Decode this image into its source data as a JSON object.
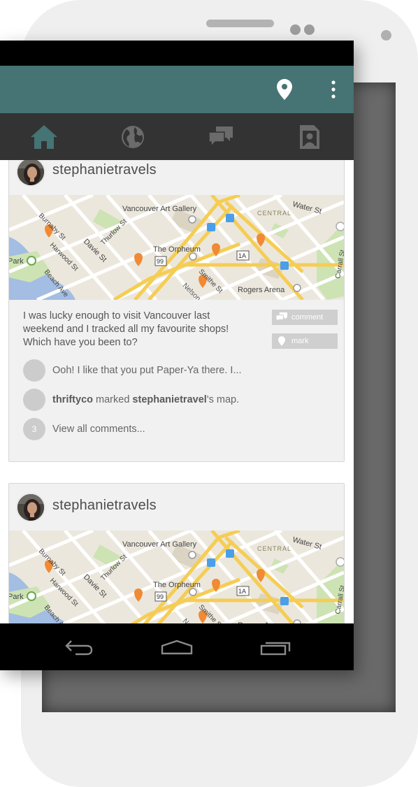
{
  "colors": {
    "action_bar": "#467373",
    "tab_bar": "#333333",
    "active_tab": "#467373",
    "inactive_tab": "#6b6b6b",
    "map_pin": "#f08a35",
    "map_road": "#f5cd54"
  },
  "action_bar": {
    "icons": [
      "location-pin-icon",
      "overflow-menu-icon"
    ]
  },
  "tabs": [
    {
      "icon": "home-icon",
      "active": true
    },
    {
      "icon": "globe-icon",
      "active": false
    },
    {
      "icon": "chat-icon",
      "active": false
    },
    {
      "icon": "profile-card-icon",
      "active": false
    }
  ],
  "map": {
    "labels": {
      "gallery": "Vancouver Art Gallery",
      "water": "Water St",
      "central": "CENTRAL",
      "burnaby": "Burnaby St",
      "thurlow": "Thurlow St",
      "davie": "Davie St",
      "harwood": "Harwood St",
      "orpheum": "The Orpheum",
      "park": "Park",
      "beach": "Beach Ave",
      "nelson": "Nelson",
      "smithe": "Smithe St",
      "rogers": "Rogers Arena",
      "carrall": "Carrall St",
      "route99": "99",
      "route1a": "1A"
    }
  },
  "posts": [
    {
      "username": "stephanietravels",
      "text_lines": [
        "I was lucky enough to visit Vancouver last",
        "weekend and I tracked all my favourite shops!",
        "Which have you been to?"
      ],
      "comment_label": "comment",
      "mark_label": "mark",
      "comments": [
        {
          "text": "Ooh! I like that you put Paper-Ya there. I..."
        },
        {
          "user": "thriftyco",
          "middle": " marked ",
          "target": "stephanietravel",
          "suffix": "'s map."
        }
      ],
      "comment_count": "3",
      "view_all_label": "View all comments..."
    },
    {
      "username": "stephanietravels"
    }
  ],
  "nav_bar": {
    "icons": [
      "back-icon",
      "home-outline-icon",
      "recent-apps-icon"
    ]
  }
}
